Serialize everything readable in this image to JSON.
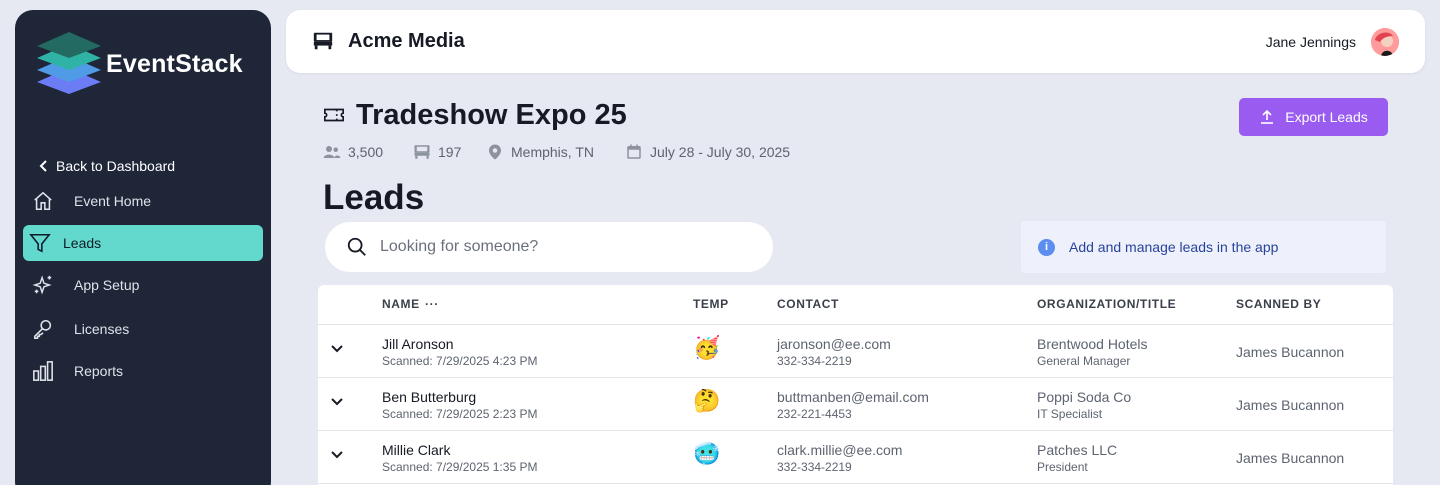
{
  "sidebar": {
    "logo_text": "EventStack",
    "back_label": "Back to Dashboard",
    "items": [
      {
        "label": "Event Home",
        "icon": "home-icon",
        "active": false
      },
      {
        "label": "Leads",
        "icon": "filter-icon",
        "active": true
      },
      {
        "label": "App Setup",
        "icon": "sparkle-icon",
        "active": false
      },
      {
        "label": "Licenses",
        "icon": "key-icon",
        "active": false
      },
      {
        "label": "Reports",
        "icon": "bar-chart-icon",
        "active": false
      }
    ]
  },
  "header": {
    "org_name": "Acme Media",
    "user_name": "Jane Jennings"
  },
  "event": {
    "title": "Tradeshow Expo 25",
    "attendees": "3,500",
    "booths": "197",
    "location": "Memphis, TN",
    "dates": "July 28 - July 30, 2025"
  },
  "export_label": "Export Leads",
  "page_title": "Leads",
  "search": {
    "placeholder": "Looking for someone?"
  },
  "info_text": "Add and manage leads in the app",
  "table": {
    "columns": {
      "name": "NAME",
      "name_menu": "···",
      "temp": "TEMP",
      "contact": "CONTACT",
      "org": "ORGANIZATION/TITLE",
      "scanned_by": "SCANNED BY"
    },
    "rows": [
      {
        "name": "Jill Aronson",
        "scanned": "Scanned: 7/29/2025 4:23 PM",
        "temp": "🥳",
        "email": "jaronson@ee.com",
        "phone": "332-334-2219",
        "org": "Brentwood Hotels",
        "title": "General Manager",
        "scanned_by": "James Bucannon"
      },
      {
        "name": "Ben Butterburg",
        "scanned": "Scanned: 7/29/2025 2:23 PM",
        "temp": "🤔",
        "email": "buttmanben@email.com",
        "phone": "232-221-4453",
        "org": "Poppi Soda Co",
        "title": "IT Specialist",
        "scanned_by": "James Bucannon"
      },
      {
        "name": "Millie Clark",
        "scanned": "Scanned: 7/29/2025 1:35 PM",
        "temp": "🥶",
        "email": "clark.millie@ee.com",
        "phone": "332-334-2219",
        "org": "Patches LLC",
        "title": "President",
        "scanned_by": "James Bucannon"
      }
    ]
  },
  "colors": {
    "sidebar": "#1f2638",
    "active_nav": "#63d8cc",
    "accent": "#9a5cf0",
    "background": "#e6e8f2"
  }
}
